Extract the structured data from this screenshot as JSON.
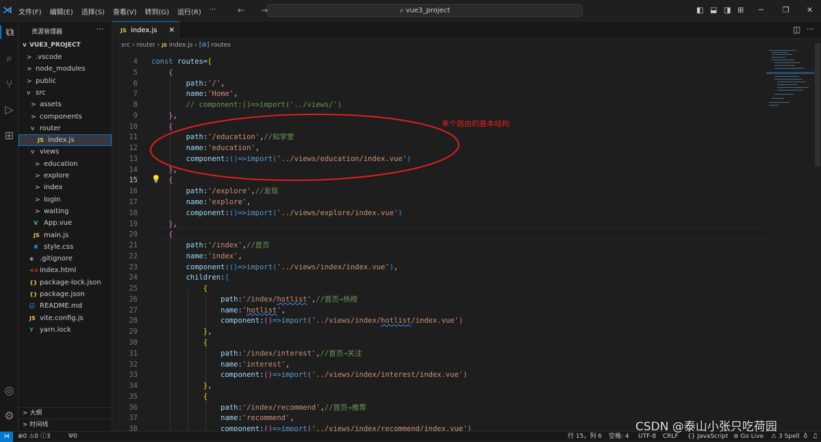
{
  "titlebar": {
    "menu": [
      "文件(F)",
      "编辑(E)",
      "选择(S)",
      "查看(V)",
      "转到(G)",
      "运行(R)",
      "···"
    ],
    "search": "vue3_project",
    "nav_arrows": "← →"
  },
  "sidebar": {
    "header": "资源管理器",
    "more": "···",
    "root": "VUE3_PROJECT",
    "tree": [
      {
        "label": ".vscode",
        "chev": ">",
        "icon": "",
        "depth": 1
      },
      {
        "label": "node_modules",
        "chev": ">",
        "icon": "",
        "depth": 1
      },
      {
        "label": "public",
        "chev": ">",
        "icon": "",
        "depth": 1
      },
      {
        "label": "src",
        "chev": "v",
        "icon": "",
        "depth": 1
      },
      {
        "label": "assets",
        "chev": ">",
        "icon": "",
        "depth": 2
      },
      {
        "label": "components",
        "chev": ">",
        "icon": "",
        "depth": 2
      },
      {
        "label": "router",
        "chev": "v",
        "icon": "",
        "depth": 2
      },
      {
        "label": "index.js",
        "chev": "",
        "icon": "JS",
        "depth": 3,
        "selected": true
      },
      {
        "label": "views",
        "chev": "v",
        "icon": "",
        "depth": 2
      },
      {
        "label": "education",
        "chev": ">",
        "icon": "",
        "depth": 3
      },
      {
        "label": "explore",
        "chev": ">",
        "icon": "",
        "depth": 3
      },
      {
        "label": "index",
        "chev": ">",
        "icon": "",
        "depth": 3
      },
      {
        "label": "login",
        "chev": ">",
        "icon": "",
        "depth": 3
      },
      {
        "label": "waiting",
        "chev": ">",
        "icon": "",
        "depth": 3
      },
      {
        "label": "App.vue",
        "chev": "",
        "icon": "V",
        "depth": 2
      },
      {
        "label": "main.js",
        "chev": "",
        "icon": "JS",
        "depth": 2
      },
      {
        "label": "style.css",
        "chev": "",
        "icon": "#",
        "depth": 2
      },
      {
        "label": ".gitignore",
        "chev": "",
        "icon": "◆",
        "depth": 1
      },
      {
        "label": "index.html",
        "chev": "",
        "icon": "<>",
        "depth": 1
      },
      {
        "label": "package-lock.json",
        "chev": "",
        "icon": "{}",
        "depth": 1
      },
      {
        "label": "package.json",
        "chev": "",
        "icon": "{}",
        "depth": 1
      },
      {
        "label": "README.md",
        "chev": "",
        "icon": "ⓘ",
        "depth": 1
      },
      {
        "label": "vite.config.js",
        "chev": "",
        "icon": "JS",
        "depth": 1
      },
      {
        "label": "yarn.lock",
        "chev": "",
        "icon": "Y",
        "depth": 1
      }
    ],
    "outline": "大纲",
    "timeline": "时间线"
  },
  "tab": {
    "icon": "JS",
    "label": "index.js",
    "close": "✕"
  },
  "breadcrumb": [
    "src",
    "router",
    "index.js",
    "routes"
  ],
  "annotation": "单个路由的基本结构",
  "code_lines": [
    {
      "n": 4,
      "code": [
        {
          "t": "const ",
          "c": "k"
        },
        {
          "t": "routes",
          "c": "v"
        },
        {
          "t": "=",
          "c": "p"
        },
        {
          "t": "[",
          "c": "b1"
        }
      ]
    },
    {
      "n": 5,
      "code": [
        {
          "t": "    ",
          "c": "p"
        },
        {
          "t": "{",
          "c": "b2"
        }
      ]
    },
    {
      "n": 6,
      "code": [
        {
          "t": "        ",
          "c": "p"
        },
        {
          "t": "path",
          "c": "v"
        },
        {
          "t": ":",
          "c": "p"
        },
        {
          "t": "'/'",
          "c": "s"
        },
        {
          "t": ",",
          "c": "p"
        }
      ]
    },
    {
      "n": 7,
      "code": [
        {
          "t": "        ",
          "c": "p"
        },
        {
          "t": "name",
          "c": "v"
        },
        {
          "t": ":",
          "c": "p"
        },
        {
          "t": "'Home'",
          "c": "s"
        },
        {
          "t": ",",
          "c": "p"
        }
      ]
    },
    {
      "n": 8,
      "code": [
        {
          "t": "        ",
          "c": "p"
        },
        {
          "t": "// component:()=>import('../views/')",
          "c": "c"
        }
      ]
    },
    {
      "n": 9,
      "code": [
        {
          "t": "    ",
          "c": "p"
        },
        {
          "t": "}",
          "c": "b2"
        },
        {
          "t": ",",
          "c": "p"
        }
      ]
    },
    {
      "n": 10,
      "code": [
        {
          "t": "    ",
          "c": "p"
        },
        {
          "t": "{",
          "c": "b2"
        }
      ]
    },
    {
      "n": 11,
      "code": [
        {
          "t": "        ",
          "c": "p"
        },
        {
          "t": "path",
          "c": "v"
        },
        {
          "t": ":",
          "c": "p"
        },
        {
          "t": "'/education'",
          "c": "s"
        },
        {
          "t": ",",
          "c": "p"
        },
        {
          "t": "//知学堂",
          "c": "c"
        }
      ]
    },
    {
      "n": 12,
      "code": [
        {
          "t": "        ",
          "c": "p"
        },
        {
          "t": "name",
          "c": "v"
        },
        {
          "t": ":",
          "c": "p"
        },
        {
          "t": "'education'",
          "c": "s"
        },
        {
          "t": ",",
          "c": "p"
        }
      ]
    },
    {
      "n": 13,
      "code": [
        {
          "t": "        ",
          "c": "p"
        },
        {
          "t": "component",
          "c": "v"
        },
        {
          "t": ":",
          "c": "p"
        },
        {
          "t": "()",
          "c": "b3"
        },
        {
          "t": "=>",
          "c": "k"
        },
        {
          "t": "import",
          "c": "k"
        },
        {
          "t": "(",
          "c": "b3"
        },
        {
          "t": "'../views/education/index.vue'",
          "c": "s"
        },
        {
          "t": ")",
          "c": "b3"
        }
      ]
    },
    {
      "n": 14,
      "code": [
        {
          "t": "    ",
          "c": "p"
        },
        {
          "t": "}",
          "c": "b2"
        },
        {
          "t": ",",
          "c": "p"
        }
      ]
    },
    {
      "n": 15,
      "code": [
        {
          "t": "    ",
          "c": "p"
        },
        {
          "t": "{",
          "c": "b2"
        }
      ],
      "current": true
    },
    {
      "n": 16,
      "code": [
        {
          "t": "        ",
          "c": "p"
        },
        {
          "t": "path",
          "c": "v"
        },
        {
          "t": ":",
          "c": "p"
        },
        {
          "t": "'/explore'",
          "c": "s"
        },
        {
          "t": ",",
          "c": "p"
        },
        {
          "t": "//发现",
          "c": "c"
        }
      ]
    },
    {
      "n": 17,
      "code": [
        {
          "t": "        ",
          "c": "p"
        },
        {
          "t": "name",
          "c": "v"
        },
        {
          "t": ":",
          "c": "p"
        },
        {
          "t": "'explore'",
          "c": "s"
        },
        {
          "t": ",",
          "c": "p"
        }
      ]
    },
    {
      "n": 18,
      "code": [
        {
          "t": "        ",
          "c": "p"
        },
        {
          "t": "component",
          "c": "v"
        },
        {
          "t": ":",
          "c": "p"
        },
        {
          "t": "()",
          "c": "b3"
        },
        {
          "t": "=>",
          "c": "k"
        },
        {
          "t": "import",
          "c": "k"
        },
        {
          "t": "(",
          "c": "b3"
        },
        {
          "t": "'../views/explore/index.vue'",
          "c": "s"
        },
        {
          "t": ")",
          "c": "b3"
        }
      ]
    },
    {
      "n": 19,
      "code": [
        {
          "t": "    ",
          "c": "p"
        },
        {
          "t": "}",
          "c": "b2"
        },
        {
          "t": ",",
          "c": "p"
        }
      ]
    },
    {
      "n": 20,
      "code": [
        {
          "t": "    ",
          "c": "p"
        },
        {
          "t": "{",
          "c": "b2"
        }
      ]
    },
    {
      "n": 21,
      "code": [
        {
          "t": "        ",
          "c": "p"
        },
        {
          "t": "path",
          "c": "v"
        },
        {
          "t": ":",
          "c": "p"
        },
        {
          "t": "'/index'",
          "c": "s"
        },
        {
          "t": ",",
          "c": "p"
        },
        {
          "t": "//首页",
          "c": "c"
        }
      ]
    },
    {
      "n": 22,
      "code": [
        {
          "t": "        ",
          "c": "p"
        },
        {
          "t": "name",
          "c": "v"
        },
        {
          "t": ":",
          "c": "p"
        },
        {
          "t": "'index'",
          "c": "s"
        },
        {
          "t": ",",
          "c": "p"
        }
      ]
    },
    {
      "n": 23,
      "code": [
        {
          "t": "        ",
          "c": "p"
        },
        {
          "t": "component",
          "c": "v"
        },
        {
          "t": ":",
          "c": "p"
        },
        {
          "t": "()",
          "c": "b3"
        },
        {
          "t": "=>",
          "c": "k"
        },
        {
          "t": "import",
          "c": "k"
        },
        {
          "t": "(",
          "c": "b3"
        },
        {
          "t": "'../views/index/index.vue'",
          "c": "s"
        },
        {
          "t": ")",
          "c": "b3"
        },
        {
          "t": ",",
          "c": "p"
        }
      ]
    },
    {
      "n": 24,
      "code": [
        {
          "t": "        ",
          "c": "p"
        },
        {
          "t": "children",
          "c": "v"
        },
        {
          "t": ":",
          "c": "p"
        },
        {
          "t": "[",
          "c": "b3"
        }
      ]
    },
    {
      "n": 25,
      "code": [
        {
          "t": "            ",
          "c": "p"
        },
        {
          "t": "{",
          "c": "b1"
        }
      ]
    },
    {
      "n": 26,
      "code": [
        {
          "t": "                ",
          "c": "p"
        },
        {
          "t": "path",
          "c": "v"
        },
        {
          "t": ":",
          "c": "p"
        },
        {
          "t": "'/index/",
          "c": "s"
        },
        {
          "t": "hotlist",
          "c": "s sq"
        },
        {
          "t": "'",
          "c": "s"
        },
        {
          "t": ",",
          "c": "p"
        },
        {
          "t": "//首页→热榜",
          "c": "c"
        }
      ]
    },
    {
      "n": 27,
      "code": [
        {
          "t": "                ",
          "c": "p"
        },
        {
          "t": "name",
          "c": "v"
        },
        {
          "t": ":",
          "c": "p"
        },
        {
          "t": "'",
          "c": "s"
        },
        {
          "t": "hotlist",
          "c": "s sq"
        },
        {
          "t": "'",
          "c": "s"
        },
        {
          "t": ",",
          "c": "p"
        }
      ]
    },
    {
      "n": 28,
      "code": [
        {
          "t": "                ",
          "c": "p"
        },
        {
          "t": "component",
          "c": "v"
        },
        {
          "t": ":",
          "c": "p"
        },
        {
          "t": "()",
          "c": "b2"
        },
        {
          "t": "=>",
          "c": "k"
        },
        {
          "t": "import",
          "c": "k"
        },
        {
          "t": "(",
          "c": "b2"
        },
        {
          "t": "'../views/index/",
          "c": "s"
        },
        {
          "t": "hotlist",
          "c": "s sq"
        },
        {
          "t": "/index.vue'",
          "c": "s"
        },
        {
          "t": ")",
          "c": "b2"
        }
      ]
    },
    {
      "n": 29,
      "code": [
        {
          "t": "            ",
          "c": "p"
        },
        {
          "t": "}",
          "c": "b1"
        },
        {
          "t": ",",
          "c": "p"
        }
      ]
    },
    {
      "n": 30,
      "code": [
        {
          "t": "            ",
          "c": "p"
        },
        {
          "t": "{",
          "c": "b1"
        }
      ]
    },
    {
      "n": 31,
      "code": [
        {
          "t": "                ",
          "c": "p"
        },
        {
          "t": "path",
          "c": "v"
        },
        {
          "t": ":",
          "c": "p"
        },
        {
          "t": "'/index/interest'",
          "c": "s"
        },
        {
          "t": ",",
          "c": "p"
        },
        {
          "t": "//首页→关注",
          "c": "c"
        }
      ]
    },
    {
      "n": 32,
      "code": [
        {
          "t": "                ",
          "c": "p"
        },
        {
          "t": "name",
          "c": "v"
        },
        {
          "t": ":",
          "c": "p"
        },
        {
          "t": "'interest'",
          "c": "s"
        },
        {
          "t": ",",
          "c": "p"
        }
      ]
    },
    {
      "n": 33,
      "code": [
        {
          "t": "                ",
          "c": "p"
        },
        {
          "t": "component",
          "c": "v"
        },
        {
          "t": ":",
          "c": "p"
        },
        {
          "t": "()",
          "c": "b2"
        },
        {
          "t": "=>",
          "c": "k"
        },
        {
          "t": "import",
          "c": "k"
        },
        {
          "t": "(",
          "c": "b2"
        },
        {
          "t": "'../views/index/interest/index.vue'",
          "c": "s"
        },
        {
          "t": ")",
          "c": "b2"
        }
      ]
    },
    {
      "n": 34,
      "code": [
        {
          "t": "            ",
          "c": "p"
        },
        {
          "t": "}",
          "c": "b1"
        },
        {
          "t": ",",
          "c": "p"
        }
      ]
    },
    {
      "n": 35,
      "code": [
        {
          "t": "            ",
          "c": "p"
        },
        {
          "t": "{",
          "c": "b1"
        }
      ]
    },
    {
      "n": 36,
      "code": [
        {
          "t": "                ",
          "c": "p"
        },
        {
          "t": "path",
          "c": "v"
        },
        {
          "t": ":",
          "c": "p"
        },
        {
          "t": "'/index/recommend'",
          "c": "s"
        },
        {
          "t": ",",
          "c": "p"
        },
        {
          "t": "//首页→推荐",
          "c": "c"
        }
      ]
    },
    {
      "n": 37,
      "code": [
        {
          "t": "                ",
          "c": "p"
        },
        {
          "t": "name",
          "c": "v"
        },
        {
          "t": ":",
          "c": "p"
        },
        {
          "t": "'recommend'",
          "c": "s"
        },
        {
          "t": ",",
          "c": "p"
        }
      ]
    },
    {
      "n": 38,
      "code": [
        {
          "t": "                ",
          "c": "p"
        },
        {
          "t": "component",
          "c": "v"
        },
        {
          "t": ":",
          "c": "p"
        },
        {
          "t": "()",
          "c": "b2"
        },
        {
          "t": "=>",
          "c": "k"
        },
        {
          "t": "import",
          "c": "k"
        },
        {
          "t": "(",
          "c": "b2"
        },
        {
          "t": "'../views/index/recommend/index.vue'",
          "c": "s"
        },
        {
          "t": ")",
          "c": "b2"
        }
      ]
    }
  ],
  "statusbar": {
    "problems": "⊗0 ⚠0 ⓘ3",
    "ports": "Ψ0",
    "position": "行 15，列 6",
    "indent": "空格: 4",
    "encoding": "UTF-8",
    "eol": "CRLF",
    "language": "{} JavaScript",
    "golive": "Go Live",
    "spell": "3 Spell"
  },
  "watermark": "CSDN @泰山小张只吃荷园",
  "colors": {
    "accent": "#0078d4",
    "annotation_red": "#e0201b",
    "bulb": "#ffcc00"
  }
}
